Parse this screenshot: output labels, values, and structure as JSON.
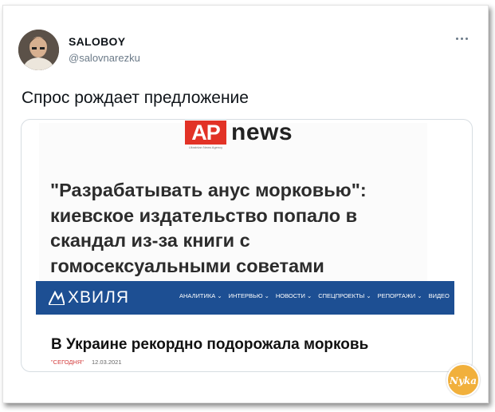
{
  "author": {
    "name": "SALOBOY",
    "handle": "@salovnarezku"
  },
  "tweet": {
    "text": "Спрос рождает предложение"
  },
  "ap_news": {
    "logo_box": "AP",
    "logo_word": "news",
    "logo_sub": "Ukrainian News Agency",
    "headline": "\"Разрабатывать анус морковью\": киевское издательство попало в скандал из-за книги с гомосексуальными советами",
    "accent_color": "#e23226"
  },
  "hvylya": {
    "logo_text": "ХВИЛЯ",
    "nav": [
      "АНАЛИТИКА ⌄",
      "ИНТЕРВЬЮ ⌄",
      "НОВОСТИ ⌄",
      "СПЕЦПРОЕКТЫ ⌄",
      "РЕПОРТАЖИ ⌄",
      "ВИДЕО"
    ],
    "headline": "В Украине рекордно подорожала морковь",
    "today_label": "\"СЕГОДНЯ\"",
    "date": "12.03.2021",
    "bar_color": "#1d4f93"
  },
  "watermark": {
    "text": "Nyka"
  }
}
